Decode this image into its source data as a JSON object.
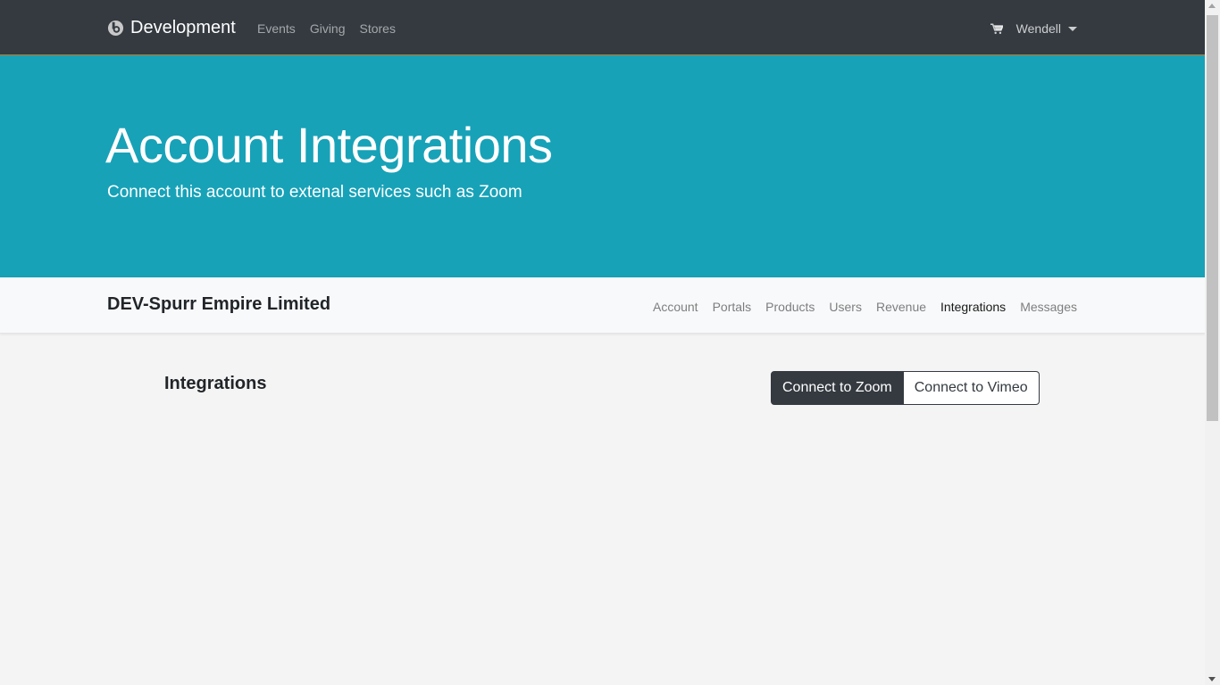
{
  "navbar": {
    "brand": "Development",
    "brand_icon": "logo-icon",
    "links": [
      "Events",
      "Giving",
      "Stores"
    ],
    "cart_icon": "shopping-cart-icon",
    "user": "Wendell"
  },
  "hero": {
    "title": "Account Integrations",
    "subtitle": "Connect this account to extenal services such as Zoom",
    "background_color": "#17a2b8"
  },
  "subnav": {
    "org_name": "DEV-Spurr Empire Limited",
    "links": [
      "Account",
      "Portals",
      "Products",
      "Users",
      "Revenue",
      "Integrations",
      "Messages"
    ],
    "active": "Integrations"
  },
  "content": {
    "title": "Integrations",
    "buttons": {
      "zoom": "Connect to Zoom",
      "vimeo": "Connect to Vimeo"
    }
  }
}
